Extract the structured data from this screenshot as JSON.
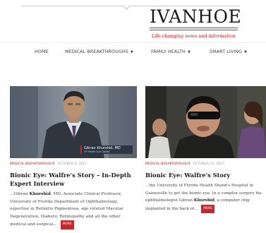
{
  "header": {
    "logo": "IVANHOE",
    "tagline": "Life-changing news and information"
  },
  "nav": {
    "items": [
      {
        "label": "HOME",
        "has_menu": false
      },
      {
        "label": "MEDICAL BREAKTHROUGHS",
        "has_menu": true
      },
      {
        "label": "FAMILY HEALTH",
        "has_menu": true
      },
      {
        "label": "SMART LIVING",
        "has_menu": true
      }
    ]
  },
  "articles": [
    {
      "image_caption_name": "Gibran Khurshid, MD",
      "image_caption_org": "UF Health Eye Center",
      "category": "MEDICAL BREAKTHROUGHS",
      "date": "OCTOBER 4, 2017",
      "title": "Bionic Eye: Walfre's Story – In-Depth Expert Interview",
      "excerpt_lines": [
        "...Gibran Khurshid, MD, Associate Clinical Professor,",
        "University of Florida Department of Ophthalmology,",
        "expertise in Retinitis Pigmentosa, age related Macular",
        "Degeneration, Diabetic Retinopathy and all the other",
        "medical and surgical..."
      ],
      "more_label": "MORE"
    },
    {
      "category": "MEDICAL BREAKTHROUGHS",
      "date": "OCTOBER 13, 2017",
      "title": "Bionic Eye: Walfre's Story",
      "excerpt_lines": [
        "...the University of Florida Health Shand's Hospital in",
        "Gainesville to get the bionic eye. In a complex surgery his",
        "ophthalmologist Gibran Khurshid, a computer chip",
        "implanted in the back of..."
      ],
      "more_label": "MORE"
    }
  ],
  "colors": {
    "accent": "#b51b1b",
    "more_button": "#c02b2b"
  }
}
